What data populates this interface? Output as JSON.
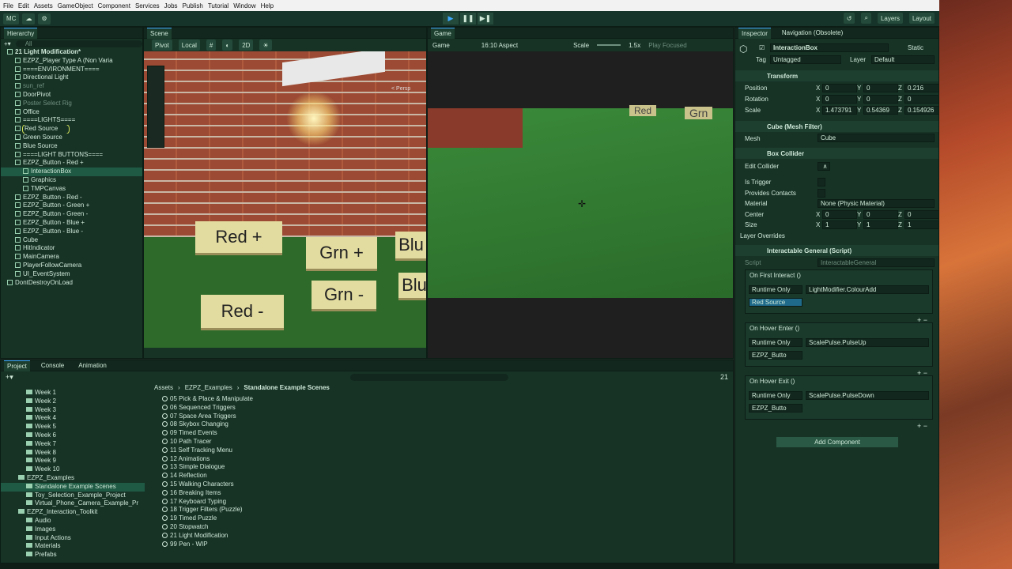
{
  "menubar": [
    "File",
    "Edit",
    "Assets",
    "GameObject",
    "Component",
    "Services",
    "Jobs",
    "Publish",
    "Tutorial",
    "Window",
    "Help"
  ],
  "toolbar": {
    "account": "MC",
    "layers": "Layers",
    "layout": "Layout"
  },
  "hierarchy": {
    "tab": "Hierarchy",
    "search": "All",
    "items": [
      {
        "t": "21 Light Modification*",
        "d": 0,
        "cls": "bold"
      },
      {
        "t": "EZPZ_Player Type A (Non Varia",
        "d": 1
      },
      {
        "t": "====ENVIRONMENT====",
        "d": 1
      },
      {
        "t": "Directional Light",
        "d": 1
      },
      {
        "t": "sun_ref",
        "d": 1,
        "cls": "dim"
      },
      {
        "t": "DoorPivot",
        "d": 1
      },
      {
        "t": "Poster Select Rig",
        "d": 1,
        "cls": "dim"
      },
      {
        "t": "Office",
        "d": 1
      },
      {
        "t": "====LIGHTS====",
        "d": 1
      },
      {
        "t": "Red Source",
        "d": 1,
        "cls": "red"
      },
      {
        "t": "Green Source",
        "d": 1
      },
      {
        "t": "Blue Source",
        "d": 1
      },
      {
        "t": "====LIGHT BUTTONS====",
        "d": 1
      },
      {
        "t": "EZPZ_Button - Red +",
        "d": 1
      },
      {
        "t": "InteractionBox",
        "d": 2,
        "cls": "sel"
      },
      {
        "t": "Graphics",
        "d": 2
      },
      {
        "t": "TMPCanvas",
        "d": 2
      },
      {
        "t": "EZPZ_Button - Red -",
        "d": 1
      },
      {
        "t": "EZPZ_Button - Green +",
        "d": 1
      },
      {
        "t": "EZPZ_Button - Green -",
        "d": 1
      },
      {
        "t": "EZPZ_Button - Blue +",
        "d": 1
      },
      {
        "t": "EZPZ_Button - Blue -",
        "d": 1
      },
      {
        "t": "Cube",
        "d": 1
      },
      {
        "t": "HitIndicator",
        "d": 1
      },
      {
        "t": "MainCamera",
        "d": 1
      },
      {
        "t": "PlayerFollowCamera",
        "d": 1
      },
      {
        "t": "UI_EventSystem",
        "d": 1
      },
      {
        "t": "DontDestroyOnLoad",
        "d": 0
      }
    ]
  },
  "scene": {
    "tab": "Scene",
    "pivot": "Pivot",
    "local": "Local",
    "mode2d": "2D",
    "persp": "< Persp",
    "plates": [
      "Red +",
      "Grn +",
      "Blu",
      "Red -",
      "Grn -",
      "Blu"
    ]
  },
  "game": {
    "tab": "Game",
    "display": "Game",
    "aspect": "16:10 Aspect",
    "scale_label": "Scale",
    "scale": "1.5x",
    "play_focused": "Play Focused",
    "signs": [
      "Red",
      "Grn"
    ]
  },
  "inspector": {
    "tab": "Inspector",
    "tab2": "Navigation (Obsolete)",
    "name": "InteractionBox",
    "static": "Static",
    "tag_label": "Tag",
    "tag": "Untagged",
    "layer_label": "Layer",
    "layer": "Default",
    "transform": "Transform",
    "pos_label": "Position",
    "rot_label": "Rotation",
    "scale_label": "Scale",
    "pos": [
      "0",
      "0",
      "0.216"
    ],
    "rot": [
      "0",
      "0",
      "0"
    ],
    "scl": [
      "1.473791",
      "0.54369",
      "0.154926"
    ],
    "meshfilter": "Cube (Mesh Filter)",
    "mesh_label": "Mesh",
    "mesh": "Cube",
    "collider": "Box Collider",
    "edit_collider": "Edit Collider",
    "is_trigger": "Is Trigger",
    "provides": "Provides Contacts",
    "material_label": "Material",
    "material": "None (Physic Material)",
    "center_label": "Center",
    "center": [
      "0",
      "0",
      "0"
    ],
    "size_label": "Size",
    "size": [
      "1",
      "1",
      "1"
    ],
    "overrides": "Layer Overrides",
    "script_comp": "Interactable General (Script)",
    "script_label": "Script",
    "script": "InteractableGeneral",
    "events": [
      {
        "title": "On First Interact ()",
        "mode": "Runtime Only",
        "fn": "LightModifier.ColourAdd",
        "obj": "Red Source"
      },
      {
        "title": "On Hover Enter ()",
        "mode": "Runtime Only",
        "fn": "ScalePulse.PulseUp",
        "obj": "EZPZ_Butto"
      },
      {
        "title": "On Hover Exit ()",
        "mode": "Runtime Only",
        "fn": "ScalePulse.PulseDown",
        "obj": "EZPZ_Butto"
      }
    ],
    "add_component": "Add Component",
    "axes": [
      "X",
      "Y",
      "Z"
    ]
  },
  "project": {
    "tabs": [
      "Project",
      "Console",
      "Animation"
    ],
    "count": "21",
    "breadcrumb": [
      "Assets",
      "EZPZ_Examples",
      "Standalone Example Scenes"
    ],
    "tree": [
      {
        "t": "Week 1",
        "d": 2
      },
      {
        "t": "Week 2",
        "d": 2
      },
      {
        "t": "Week 3",
        "d": 2
      },
      {
        "t": "Week 4",
        "d": 2
      },
      {
        "t": "Week 5",
        "d": 2
      },
      {
        "t": "Week 6",
        "d": 2
      },
      {
        "t": "Week 7",
        "d": 2
      },
      {
        "t": "Week 8",
        "d": 2
      },
      {
        "t": "Week 9",
        "d": 2
      },
      {
        "t": "Week 10",
        "d": 2
      },
      {
        "t": "EZPZ_Examples",
        "d": 1
      },
      {
        "t": "Standalone Example Scenes",
        "d": 2,
        "cls": "sel"
      },
      {
        "t": "Toy_Selection_Example_Project",
        "d": 2
      },
      {
        "t": "Virtual_Phone_Camera_Example_Pr",
        "d": 2
      },
      {
        "t": "EZPZ_Interaction_Toolkit",
        "d": 1
      },
      {
        "t": "Audio",
        "d": 2
      },
      {
        "t": "Images",
        "d": 2
      },
      {
        "t": "Input Actions",
        "d": 2
      },
      {
        "t": "Materials",
        "d": 2
      },
      {
        "t": "Prefabs",
        "d": 2
      }
    ],
    "files": [
      "05 Pick & Place & Manipulate",
      "06 Sequenced Triggers",
      "07 Space Area Triggers",
      "08 Skybox Changing",
      "09 Timed Events",
      "10 Path Tracer",
      "11 Self Tracking Menu",
      "12 Animations",
      "13 Simple Dialogue",
      "14 Reflection",
      "15 Walking Characters",
      "16 Breaking Items",
      "17 Keyboard Typing",
      "18 Trigger Filters (Puzzle)",
      "19 Timed Puzzle",
      "20 Stopwatch",
      "21 Light Modification",
      "99 Pen - WIP"
    ]
  }
}
